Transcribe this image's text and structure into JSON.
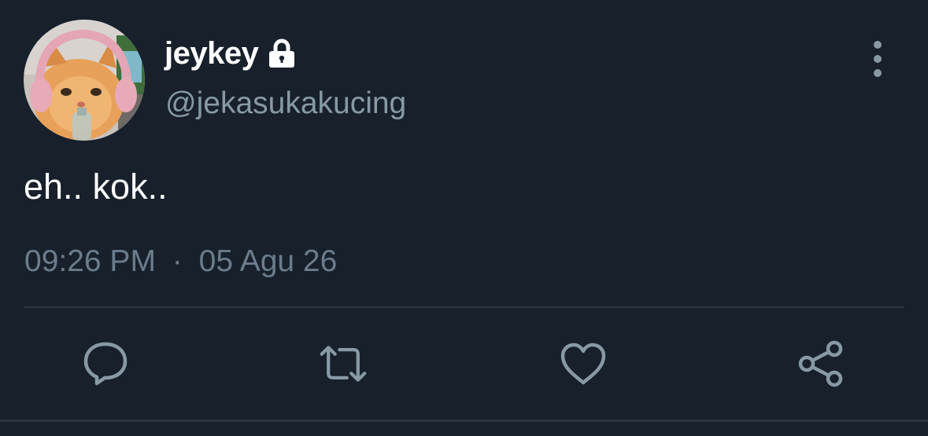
{
  "tweet": {
    "author": {
      "display_name": "jeykey",
      "handle": "@jekasukakucing",
      "protected_icon": "lock-icon",
      "avatar": "avatar-cat-with-headphones"
    },
    "text": "eh.. kok..",
    "timestamp": {
      "time": "09:26 PM",
      "separator": "·",
      "date": "05 Agu 26"
    },
    "actions": [
      {
        "icon": "reply-icon",
        "name": "reply-button"
      },
      {
        "icon": "retweet-icon",
        "name": "retweet-button"
      },
      {
        "icon": "heart-icon",
        "name": "like-button"
      },
      {
        "icon": "share-icon",
        "name": "share-button"
      }
    ],
    "menu_icon": "more-vertical-icon"
  },
  "colors": {
    "background": "#17202b",
    "primary_text": "#ffffff",
    "secondary_text": "#8899a6",
    "divider": "#2d3743"
  }
}
